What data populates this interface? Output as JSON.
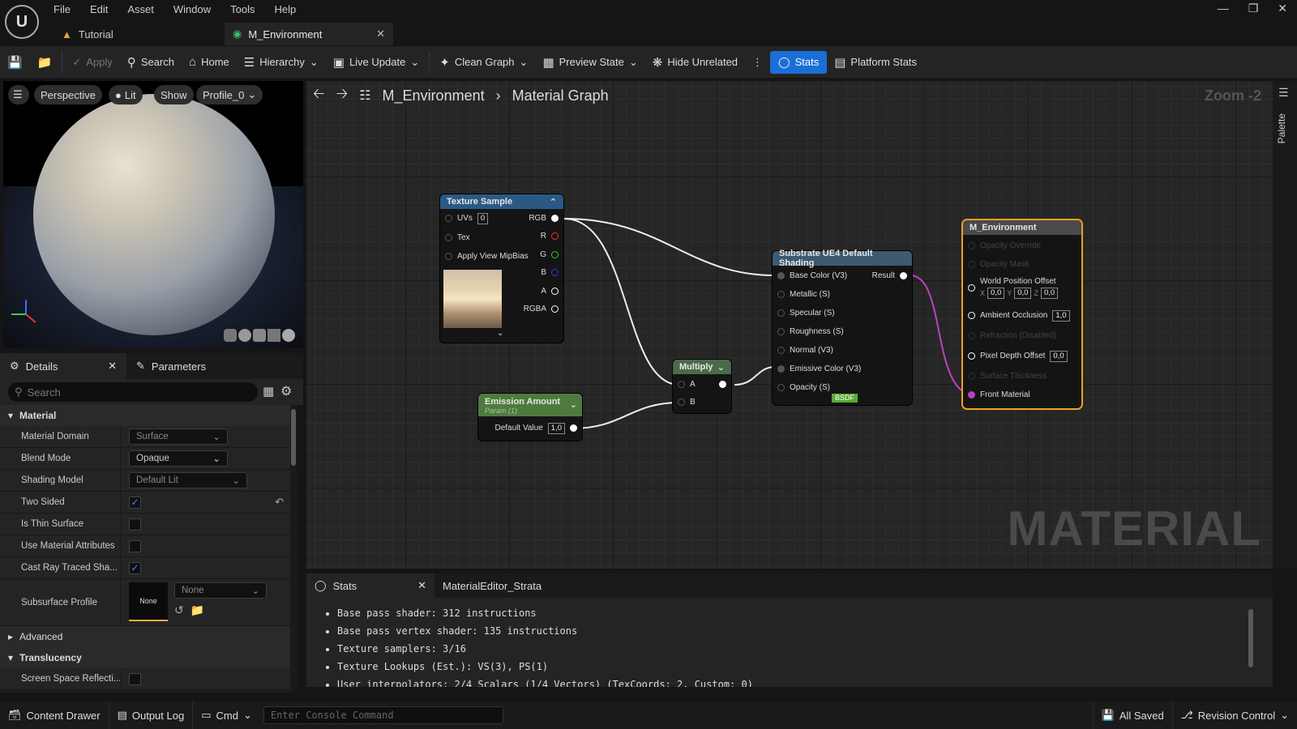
{
  "menu": [
    "File",
    "Edit",
    "Asset",
    "Window",
    "Tools",
    "Help"
  ],
  "tabs": [
    {
      "label": "Tutorial"
    },
    {
      "label": "M_Environment"
    }
  ],
  "toolbar": {
    "apply": "Apply",
    "search": "Search",
    "home": "Home",
    "hierarchy": "Hierarchy",
    "live_update": "Live Update",
    "clean_graph": "Clean Graph",
    "preview_state": "Preview State",
    "hide_unrelated": "Hide Unrelated",
    "stats": "Stats",
    "platform_stats": "Platform Stats"
  },
  "viewport": {
    "perspective": "Perspective",
    "lit": "Lit",
    "show": "Show",
    "profile": "Profile_0"
  },
  "details": {
    "tab_details": "Details",
    "tab_parameters": "Parameters",
    "search_placeholder": "Search",
    "cat_material": "Material",
    "cat_advanced": "Advanced",
    "cat_translucency": "Translucency",
    "rows": [
      {
        "label": "Material Domain",
        "value": "Surface"
      },
      {
        "label": "Blend Mode",
        "value": "Opaque"
      },
      {
        "label": "Shading Model",
        "value": "Default Lit"
      },
      {
        "label": "Two Sided",
        "checked": true
      },
      {
        "label": "Is Thin Surface",
        "checked": false
      },
      {
        "label": "Use Material Attributes",
        "checked": false
      },
      {
        "label": "Cast Ray Traced Sha...",
        "checked": true
      }
    ],
    "subsurface_label": "Subsurface Profile",
    "subsurface_thumb": "None",
    "subsurface_value": "None",
    "ssr_label": "Screen Space Reflecti..."
  },
  "graph": {
    "crumb_root": "M_Environment",
    "crumb_sub": "Material Graph",
    "zoom": "Zoom -2",
    "watermark": "MATERIAL",
    "palette": "Palette",
    "texture_sample": {
      "title": "Texture Sample",
      "uvs": "UVs",
      "uvs_val": "0",
      "tex": "Tex",
      "mipbias": "Apply View MipBias",
      "outs": [
        "RGB",
        "R",
        "G",
        "B",
        "A",
        "RGBA"
      ]
    },
    "emission": {
      "title": "Emission Amount",
      "sub": "Param (1)",
      "default_label": "Default Value",
      "default_val": "1,0"
    },
    "multiply": {
      "title": "Multiply",
      "a": "A",
      "b": "B"
    },
    "substrate": {
      "title": "Substrate UE4 Default Shading",
      "result": "Result",
      "badge": "BSDF",
      "inputs": [
        "Base Color (V3)",
        "Metallic (S)",
        "Specular (S)",
        "Roughness (S)",
        "Normal (V3)",
        "Emissive Color (V3)",
        "Opacity (S)"
      ]
    },
    "output": {
      "title": "M_Environment",
      "opacity_override": "Opacity Override",
      "opacity_mask": "Opacity Mask",
      "wpo": "World Position Offset",
      "x": "X",
      "y": "Y",
      "z": "Z",
      "xv": "0,0",
      "yv": "0,0",
      "zv": "0,0",
      "ao": "Ambient Occlusion",
      "ao_val": "1,0",
      "refraction": "Refraction (Disabled)",
      "pdo": "Pixel Depth Offset",
      "pdo_val": "0,0",
      "surface_thickness": "Surface Thickness",
      "front_material": "Front Material"
    }
  },
  "stats": {
    "tab_stats": "Stats",
    "tab_strata": "MaterialEditor_Strata",
    "lines": [
      "Base pass shader: 312 instructions",
      "Base pass vertex shader: 135 instructions",
      "Texture samplers: 3/16",
      "Texture Lookups (Est.): VS(3), PS(1)",
      "User interpolators: 2/4 Scalars (1/4 Vectors) (TexCoords: 2, Custom: 0)"
    ]
  },
  "statusbar": {
    "content_drawer": "Content Drawer",
    "output_log": "Output Log",
    "cmd": "Cmd",
    "console_placeholder": "Enter Console Command",
    "all_saved": "All Saved",
    "revision_control": "Revision Control"
  },
  "colors": {
    "accent": "#1a6fd6",
    "output_border": "#f0a020",
    "wire_pink": "#c040c0",
    "texture_header": "#2a5a84",
    "emission_header": "#4f7a3f",
    "substrate_header": "#3d5a70"
  }
}
